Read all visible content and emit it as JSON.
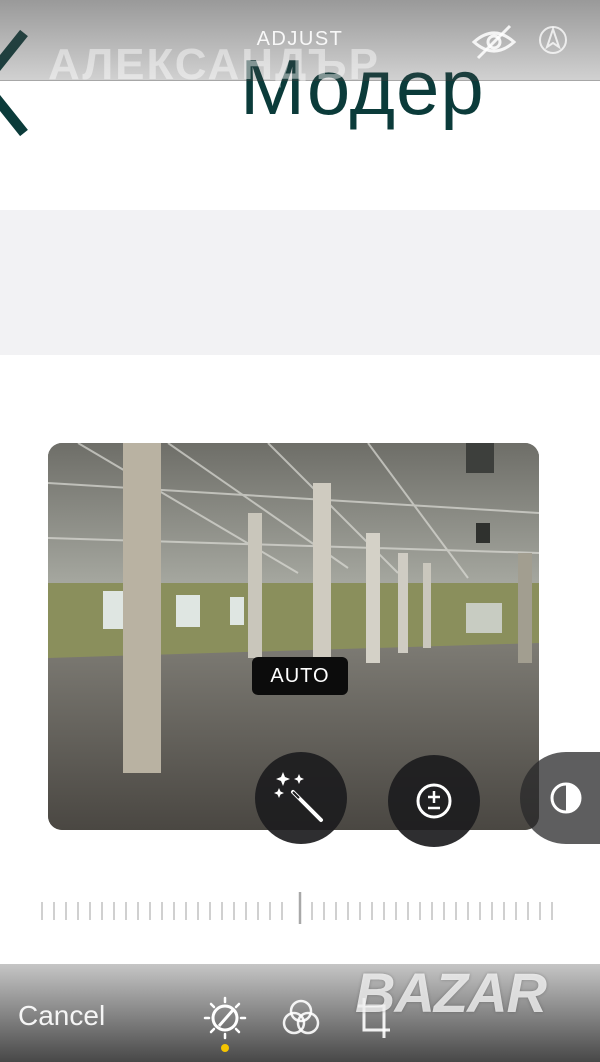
{
  "background_page": {
    "title": "Модер"
  },
  "header": {
    "ghost_title": "АЛЕКСАНДЪР",
    "title": "ADJUST",
    "hide_icon": "eye-slash-icon",
    "auto_icon": "auto-enhance-icon"
  },
  "photo": {
    "badge": "AUTO"
  },
  "tools": [
    {
      "name": "auto-wand-icon"
    },
    {
      "name": "exposure-icon"
    },
    {
      "name": "brilliance-icon"
    }
  ],
  "toolbar": {
    "cancel_label": "Cancel",
    "tabs": [
      {
        "name": "adjust-icon",
        "active": true
      },
      {
        "name": "filters-icon",
        "active": false
      },
      {
        "name": "crop-icon",
        "active": false
      }
    ],
    "active_color": "#f5c400"
  },
  "watermark": {
    "text": "BAZAR"
  }
}
